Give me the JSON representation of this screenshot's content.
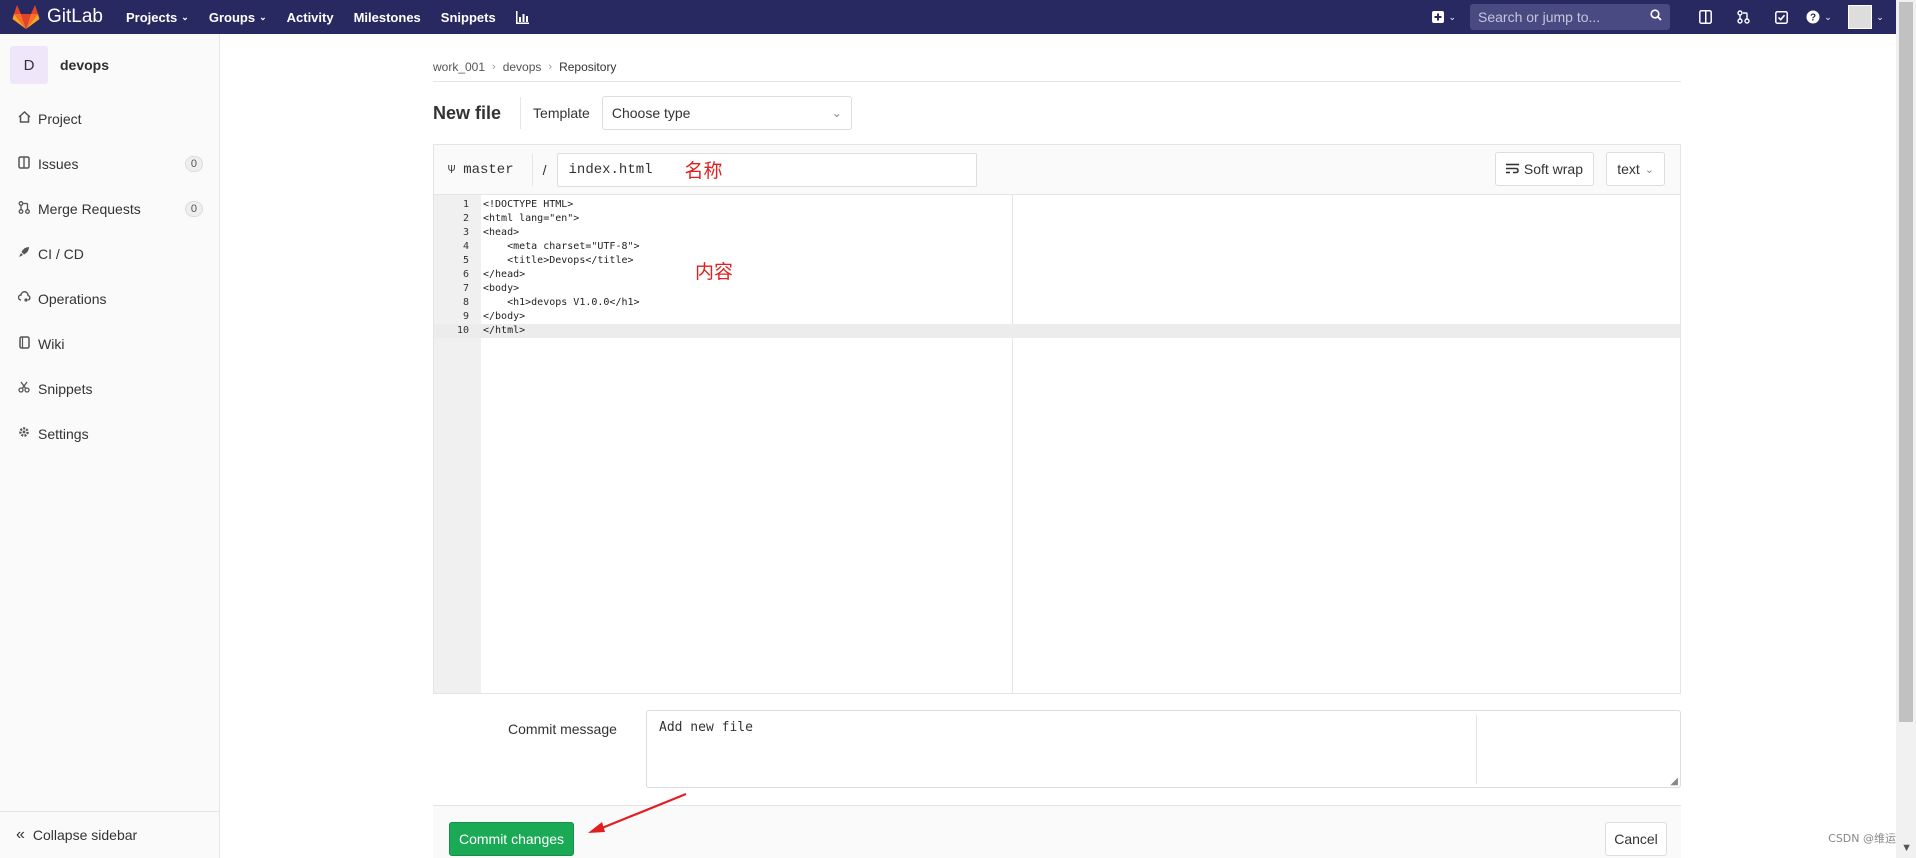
{
  "navbar": {
    "brand": "GitLab",
    "links": [
      {
        "label": "Projects",
        "dropdown": true
      },
      {
        "label": "Groups",
        "dropdown": true
      },
      {
        "label": "Activity",
        "dropdown": false
      },
      {
        "label": "Milestones",
        "dropdown": false
      },
      {
        "label": "Snippets",
        "dropdown": false
      }
    ],
    "search_placeholder": "Search or jump to...",
    "icons": [
      "plus-square-icon",
      "chart-icon",
      "sidebar-icon",
      "merge-request-icon",
      "todo-check-icon",
      "help-icon",
      "user-avatar"
    ]
  },
  "sidebar": {
    "avatar_letter": "D",
    "project_name": "devops",
    "items": [
      {
        "label": "Project",
        "icon": "home-icon"
      },
      {
        "label": "Issues",
        "icon": "issues-icon",
        "count": "0"
      },
      {
        "label": "Merge Requests",
        "icon": "merge-request-icon",
        "count": "0"
      },
      {
        "label": "CI / CD",
        "icon": "rocket-icon"
      },
      {
        "label": "Operations",
        "icon": "cloud-gear-icon"
      },
      {
        "label": "Wiki",
        "icon": "book-icon"
      },
      {
        "label": "Snippets",
        "icon": "scissors-icon"
      },
      {
        "label": "Settings",
        "icon": "gear-icon"
      }
    ],
    "collapse_label": "Collapse sidebar"
  },
  "breadcrumb": [
    "work_001",
    "devops",
    "Repository"
  ],
  "file": {
    "title": "New file",
    "template_label": "Template",
    "template_value": "Choose type"
  },
  "editor": {
    "branch": "master",
    "slash": "/",
    "filename": "index.html",
    "filename_annotation": "名称",
    "content_annotation": "内容",
    "softwrap_label": "Soft wrap",
    "mode_label": "text",
    "lines": [
      {
        "n": "1",
        "t": "<!DOCTYPE HTML>"
      },
      {
        "n": "2",
        "t": "<html lang=\"en\">"
      },
      {
        "n": "3",
        "t": "<head>"
      },
      {
        "n": "4",
        "t": "    <meta charset=\"UTF-8\">"
      },
      {
        "n": "5",
        "t": "    <title>Devops</title>"
      },
      {
        "n": "6",
        "t": "</head>"
      },
      {
        "n": "7",
        "t": "<body>"
      },
      {
        "n": "8",
        "t": "    <h1>devops V1.0.0</h1>"
      },
      {
        "n": "9",
        "t": "</body>"
      },
      {
        "n": "10",
        "t": "</html>"
      }
    ],
    "active_line": 10
  },
  "commit": {
    "label": "Commit message",
    "value": "Add new file"
  },
  "actions": {
    "commit_label": "Commit changes",
    "cancel_label": "Cancel"
  },
  "watermark": "CSDN @维运",
  "colors": {
    "navbar": "#292961",
    "commit_button": "#1aaa55",
    "annotation": "#e02020"
  }
}
